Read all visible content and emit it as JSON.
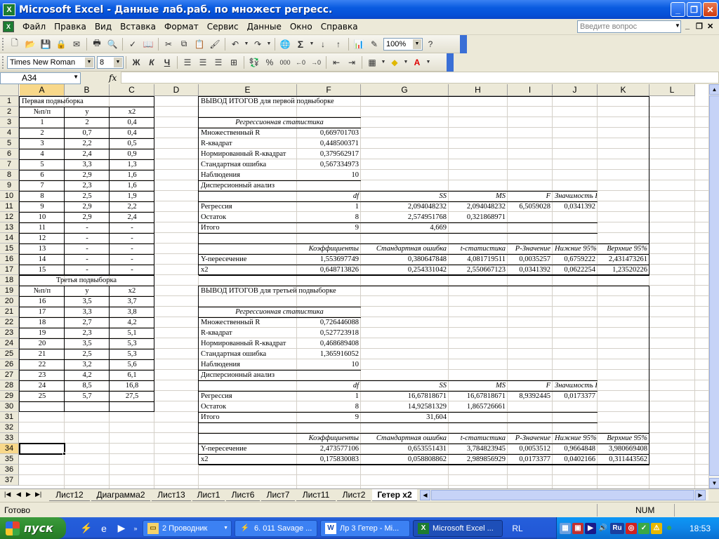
{
  "window": {
    "title": "Microsoft Excel - Данные лаб.раб. по множест регресс.",
    "icon": "excel-icon"
  },
  "menu": {
    "items": [
      "Файл",
      "Правка",
      "Вид",
      "Вставка",
      "Формат",
      "Сервис",
      "Данные",
      "Окно",
      "Справка"
    ],
    "help_placeholder": "Введите вопрос"
  },
  "toolbar": {
    "zoom": "100%",
    "font_name": "Times New Roman",
    "font_size": "8",
    "bold": "Ж",
    "italic": "К",
    "underline": "Ч",
    "sigma": "Σ",
    "percent": "%",
    "thousands": "000"
  },
  "formula_bar": {
    "cell_ref": "A34",
    "fx": "fx",
    "content": ""
  },
  "columns": [
    "A",
    "B",
    "C",
    "D",
    "E",
    "F",
    "G",
    "H",
    "I",
    "J",
    "K",
    "L"
  ],
  "selected": {
    "column": "A",
    "row": 34
  },
  "rows": [
    {
      "n": 1,
      "a": "Первая подвыборка",
      "b": "",
      "c": "",
      "e": "ВЫВОД ИТОГОВ для первой подвыборке",
      "f": "",
      "g": "",
      "h": "",
      "i": "",
      "j": "",
      "k": ""
    },
    {
      "n": 2,
      "a": "№п/п",
      "b": "y",
      "c": "x2",
      "e": "",
      "f": "",
      "g": "",
      "h": "",
      "i": "",
      "j": "",
      "k": ""
    },
    {
      "n": 3,
      "a": "1",
      "b": "2",
      "c": "0,4",
      "e": "Регрессионная статистика",
      "f": "",
      "g": "",
      "h": "",
      "i": "",
      "j": "",
      "k": ""
    },
    {
      "n": 4,
      "a": "2",
      "b": "0,7",
      "c": "0,4",
      "e": "Множественный R",
      "f": "0,669701703",
      "g": "",
      "h": "",
      "i": "",
      "j": "",
      "k": ""
    },
    {
      "n": 5,
      "a": "3",
      "b": "2,2",
      "c": "0,5",
      "e": "R-квадрат",
      "f": "0,448500371",
      "g": "",
      "h": "",
      "i": "",
      "j": "",
      "k": ""
    },
    {
      "n": 6,
      "a": "4",
      "b": "2,4",
      "c": "0,9",
      "e": "Нормированный R-квадрат",
      "f": "0,379562917",
      "g": "",
      "h": "",
      "i": "",
      "j": "",
      "k": ""
    },
    {
      "n": 7,
      "a": "5",
      "b": "3,3",
      "c": "1,3",
      "e": "Стандартная ошибка",
      "f": "0,567334973",
      "g": "",
      "h": "",
      "i": "",
      "j": "",
      "k": ""
    },
    {
      "n": 8,
      "a": "6",
      "b": "2,9",
      "c": "1,6",
      "e": "Наблюдения",
      "f": "10",
      "g": "",
      "h": "",
      "i": "",
      "j": "",
      "k": ""
    },
    {
      "n": 9,
      "a": "7",
      "b": "2,3",
      "c": "1,6",
      "e": "Дисперсионный анализ",
      "f": "",
      "g": "",
      "h": "",
      "i": "",
      "j": "",
      "k": ""
    },
    {
      "n": 10,
      "a": "8",
      "b": "2,5",
      "c": "1,9",
      "e": "",
      "f": "df",
      "g": "SS",
      "h": "MS",
      "i": "F",
      "j": "Значимость F",
      "k": ""
    },
    {
      "n": 11,
      "a": "9",
      "b": "2,9",
      "c": "2,2",
      "e": "Регрессия",
      "f": "1",
      "g": "2,094048232",
      "h": "2,094048232",
      "i": "6,5059028",
      "j": "0,0341392",
      "k": ""
    },
    {
      "n": 12,
      "a": "10",
      "b": "2,9",
      "c": "2,4",
      "e": "Остаток",
      "f": "8",
      "g": "2,574951768",
      "h": "0,321868971",
      "i": "",
      "j": "",
      "k": ""
    },
    {
      "n": 13,
      "a": "11",
      "b": "-",
      "c": "-",
      "e": "Итого",
      "f": "9",
      "g": "4,669",
      "h": "",
      "i": "",
      "j": "",
      "k": ""
    },
    {
      "n": 14,
      "a": "12",
      "b": "-",
      "c": "-",
      "e": "",
      "f": "",
      "g": "",
      "h": "",
      "i": "",
      "j": "",
      "k": ""
    },
    {
      "n": 15,
      "a": "13",
      "b": "-",
      "c": "-",
      "e": "",
      "f": "Коэффициенты",
      "g": "Стандартная ошибка",
      "h": "t-статистика",
      "i": "P-Значение",
      "j": "Нижние 95%",
      "k": "Верхние 95%"
    },
    {
      "n": 16,
      "a": "14",
      "b": "-",
      "c": "-",
      "e": "Y-пересечение",
      "f": "1,553697749",
      "g": "0,380647848",
      "h": "4,081719511",
      "i": "0,0035257",
      "j": "0,6759222",
      "k": "2,431473261"
    },
    {
      "n": 17,
      "a": "15",
      "b": "-",
      "c": "-",
      "e": "x2",
      "f": "0,648713826",
      "g": "0,254331042",
      "h": "2,550667123",
      "i": "0,0341392",
      "j": "0,0622254",
      "k": "1,23520226"
    },
    {
      "n": 18,
      "a": "Третья подвыборка",
      "b": "",
      "c": "",
      "e": "",
      "f": "",
      "g": "",
      "h": "",
      "i": "",
      "j": "",
      "k": ""
    },
    {
      "n": 19,
      "a": "№п/п",
      "b": "y",
      "c": "x2",
      "e": "ВЫВОД ИТОГОВ для третьей подвыборке",
      "f": "",
      "g": "",
      "h": "",
      "i": "",
      "j": "",
      "k": ""
    },
    {
      "n": 20,
      "a": "16",
      "b": "3,5",
      "c": "3,7",
      "e": "",
      "f": "",
      "g": "",
      "h": "",
      "i": "",
      "j": "",
      "k": ""
    },
    {
      "n": 21,
      "a": "17",
      "b": "3,3",
      "c": "3,8",
      "e": "Регрессионная статистика",
      "f": "",
      "g": "",
      "h": "",
      "i": "",
      "j": "",
      "k": ""
    },
    {
      "n": 22,
      "a": "18",
      "b": "2,7",
      "c": "4,2",
      "e": "Множественный R",
      "f": "0,726446088",
      "g": "",
      "h": "",
      "i": "",
      "j": "",
      "k": ""
    },
    {
      "n": 23,
      "a": "19",
      "b": "2,3",
      "c": "5,1",
      "e": "R-квадрат",
      "f": "0,527723918",
      "g": "",
      "h": "",
      "i": "",
      "j": "",
      "k": ""
    },
    {
      "n": 24,
      "a": "20",
      "b": "3,5",
      "c": "5,3",
      "e": "Нормированный R-квадрат",
      "f": "0,468689408",
      "g": "",
      "h": "",
      "i": "",
      "j": "",
      "k": ""
    },
    {
      "n": 25,
      "a": "21",
      "b": "2,5",
      "c": "5,3",
      "e": "Стандартная ошибка",
      "f": "1,365916052",
      "g": "",
      "h": "",
      "i": "",
      "j": "",
      "k": ""
    },
    {
      "n": 26,
      "a": "22",
      "b": "3,2",
      "c": "5,6",
      "e": "Наблюдения",
      "f": "10",
      "g": "",
      "h": "",
      "i": "",
      "j": "",
      "k": ""
    },
    {
      "n": 27,
      "a": "23",
      "b": "4,2",
      "c": "6,1",
      "e": "Дисперсионный анализ",
      "f": "",
      "g": "",
      "h": "",
      "i": "",
      "j": "",
      "k": ""
    },
    {
      "n": 28,
      "a": "24",
      "b": "8,5",
      "c": "16,8",
      "e": "",
      "f": "df",
      "g": "SS",
      "h": "MS",
      "i": "F",
      "j": "Значимость F",
      "k": ""
    },
    {
      "n": 29,
      "a": "25",
      "b": "5,7",
      "c": "27,5",
      "e": "Регрессия",
      "f": "1",
      "g": "16,67818671",
      "h": "16,67818671",
      "i": "8,9392445",
      "j": "0,0173377",
      "k": ""
    },
    {
      "n": 30,
      "a": "",
      "b": "",
      "c": "",
      "e": "Остаток",
      "f": "8",
      "g": "14,92581329",
      "h": "1,865726661",
      "i": "",
      "j": "",
      "k": ""
    },
    {
      "n": 31,
      "a": "",
      "b": "",
      "c": "",
      "e": "Итого",
      "f": "9",
      "g": "31,604",
      "h": "",
      "i": "",
      "j": "",
      "k": ""
    },
    {
      "n": 32,
      "a": "",
      "b": "",
      "c": "",
      "e": "",
      "f": "",
      "g": "",
      "h": "",
      "i": "",
      "j": "",
      "k": ""
    },
    {
      "n": 33,
      "a": "",
      "b": "",
      "c": "",
      "e": "",
      "f": "Коэффициенты",
      "g": "Стандартная ошибка",
      "h": "t-статистика",
      "i": "P-Значение",
      "j": "Нижние 95%",
      "k": "Верхние 95%"
    },
    {
      "n": 34,
      "a": "",
      "b": "",
      "c": "",
      "e": "Y-пересечение",
      "f": "2,473577106",
      "g": "0,653551431",
      "h": "3,784823945",
      "i": "0,0053512",
      "j": "0,9664848",
      "k": "3,980669408"
    },
    {
      "n": 35,
      "a": "",
      "b": "",
      "c": "",
      "e": "x2",
      "f": "0,175830083",
      "g": "0,058808862",
      "h": "2,989856929",
      "i": "0,0173377",
      "j": "0,0402166",
      "k": "0,311443562"
    },
    {
      "n": 36,
      "a": "",
      "b": "",
      "c": "",
      "e": "",
      "f": "",
      "g": "",
      "h": "",
      "i": "",
      "j": "",
      "k": ""
    },
    {
      "n": 37,
      "a": "",
      "b": "",
      "c": "",
      "e": "",
      "f": "",
      "g": "",
      "h": "",
      "i": "",
      "j": "",
      "k": ""
    }
  ],
  "sheets": [
    "Лист12",
    "Диаграмма2",
    "Лист13",
    "Лист1",
    "Лист6",
    "Лист7",
    "Лист11",
    "Лист2",
    "Гетер x2"
  ],
  "active_sheet": "Гетер x2",
  "status": {
    "left": "Готово",
    "num": "NUM"
  },
  "taskbar": {
    "start": "пуск",
    "tasks": [
      "2 Проводник",
      "6. 011 Savage ...",
      "Лр 3 Гетер - Mi...",
      "Microsoft Excel ..."
    ],
    "active_task": "Microsoft Excel ...",
    "lang": "RL",
    "tray_lang": "Ru",
    "clock": "18:53"
  }
}
